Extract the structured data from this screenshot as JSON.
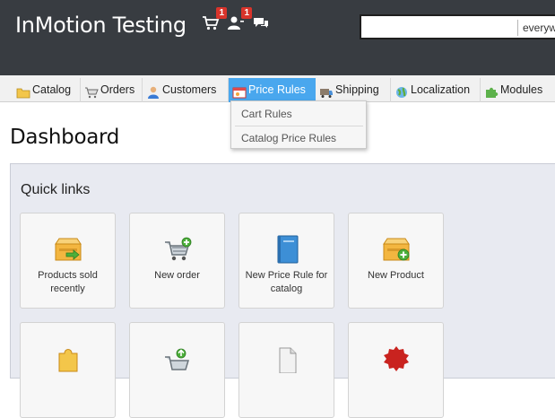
{
  "header": {
    "shop_name": "InMotion Testing",
    "cart_badge": "1",
    "customers_badge": "1",
    "search_value": "",
    "search_scope": "everyw"
  },
  "tabs": [
    {
      "label": "Catalog",
      "icon": "folder-icon"
    },
    {
      "label": "Orders",
      "icon": "cart-icon"
    },
    {
      "label": "Customers",
      "icon": "user-icon"
    },
    {
      "label": "Price Rules",
      "icon": "price-tag-icon",
      "active": true
    },
    {
      "label": "Shipping",
      "icon": "truck-icon"
    },
    {
      "label": "Localization",
      "icon": "globe-icon"
    },
    {
      "label": "Modules",
      "icon": "puzzle-icon"
    }
  ],
  "dropdown": {
    "items": [
      "Cart Rules",
      "Catalog Price Rules"
    ]
  },
  "page_title": "Dashboard",
  "quick_links": {
    "title": "Quick links",
    "items": [
      {
        "label": "Products sold recently",
        "icon": "box-arrow-icon"
      },
      {
        "label": "New order",
        "icon": "cart-add-icon"
      },
      {
        "label": "New Price Rule for catalog",
        "icon": "book-icon"
      },
      {
        "label": "New Product",
        "icon": "box-add-icon"
      }
    ]
  },
  "colors": {
    "header_bg": "#383c41",
    "accent": "#49a7ee",
    "badge": "#d9342b",
    "panel_bg": "#e8eaf1"
  }
}
